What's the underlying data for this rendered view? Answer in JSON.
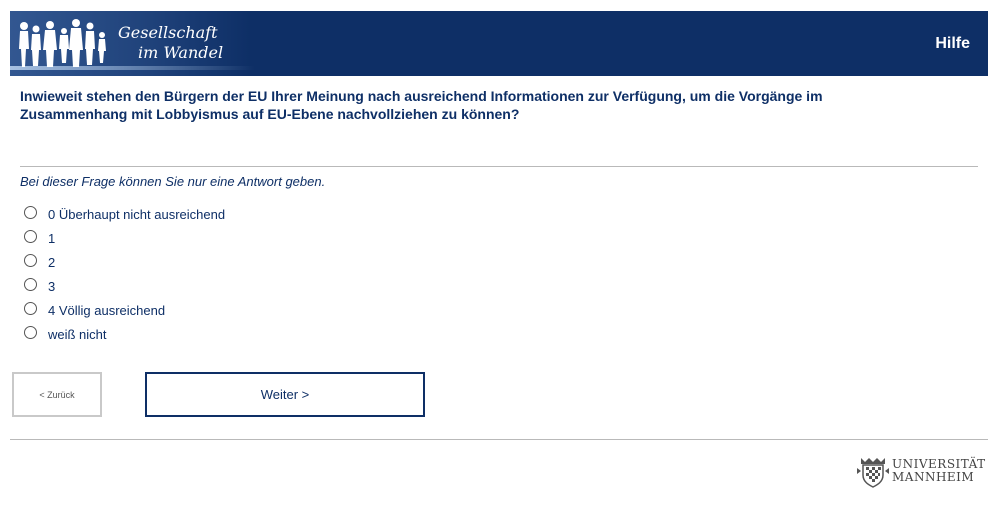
{
  "header": {
    "logo_line1": "Gesellschaft",
    "logo_line2": "im Wandel",
    "help_label": "Hilfe"
  },
  "question": {
    "text": "Inwieweit stehen den Bürgern der EU Ihrer Meinung nach ausreichend Informationen zur Verfügung, um die Vorgänge im Zusammenhang mit Lobbyismus auf EU-Ebene nachvollziehen zu können?",
    "instruction": "Bei dieser Frage können Sie nur eine Antwort geben."
  },
  "options": [
    {
      "label": "0 Überhaupt nicht ausreichend"
    },
    {
      "label": "1"
    },
    {
      "label": "2"
    },
    {
      "label": "3"
    },
    {
      "label": "4 Völlig ausreichend"
    },
    {
      "label": "weiß nicht"
    }
  ],
  "navigation": {
    "back_label": "< Zurück",
    "next_label": "Weiter >"
  },
  "footer": {
    "uni_line1": "UNIVERSITÄT",
    "uni_line2": "MANNHEIM"
  },
  "colors": {
    "brand_navy": "#0e2f66",
    "divider": "#b9b9b9"
  }
}
